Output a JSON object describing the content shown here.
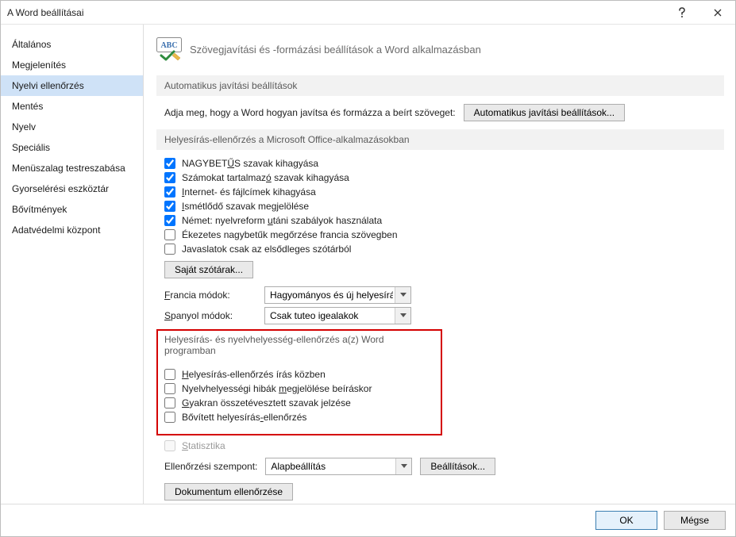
{
  "window": {
    "title": "A Word beállításai"
  },
  "sidebar": {
    "items": [
      {
        "label": "Általános"
      },
      {
        "label": "Megjelenítés"
      },
      {
        "label": "Nyelvi ellenőrzés"
      },
      {
        "label": "Mentés"
      },
      {
        "label": "Nyelv"
      },
      {
        "label": "Speciális"
      },
      {
        "label": "Menüszalag testreszabása"
      },
      {
        "label": "Gyorselérési eszköztár"
      },
      {
        "label": "Bővítmények"
      },
      {
        "label": "Adatvédelmi központ"
      }
    ],
    "selected_index": 2
  },
  "header": {
    "text": "Szövegjavítási és -formázási beállítások a Word alkalmazásban"
  },
  "section_autocorrect": {
    "title": "Automatikus javítási beállítások",
    "row_label": "Adja meg, hogy a Word hogyan javítsa és formázza a beírt szöveget:",
    "button": "Automatikus javítási beállítások..."
  },
  "section_office": {
    "title": "Helyesírás-ellenőrzés a Microsoft Office-alkalmazásokban",
    "opts": [
      {
        "pre": "NAGYBET",
        "u": "Ű",
        "post": "S szavak kihagyása",
        "checked": true
      },
      {
        "pre": "Számokat tartalmaz",
        "u": "ó",
        "post": " szavak kihagyása",
        "checked": true
      },
      {
        "pre": "",
        "u": "I",
        "post": "nternet- és fájlcímek kihagyása",
        "checked": true
      },
      {
        "pre": "",
        "u": "I",
        "post": "smétlődő szavak megjelölése",
        "checked": true
      },
      {
        "pre": "Német: nyelvreform ",
        "u": "u",
        "post": "táni szabályok használata",
        "checked": true
      },
      {
        "pre": "Ékezetes nagybetűk megőrzése francia szövegben",
        "u": "",
        "post": "",
        "checked": false
      },
      {
        "pre": "Javaslatok csak az elsődleges szótárból",
        "u": "",
        "post": "",
        "checked": false
      }
    ],
    "dict_btn": "Saját szótárak...",
    "french_label": "Francia módok:",
    "french_value": "Hagyományos és új helyesírás",
    "spanish_label": "Spanyol módok:",
    "spanish_value": "Csak tuteo igealakok"
  },
  "section_word": {
    "title": "Helyesírás- és nyelvhelyesség-ellenőrzés a(z) Word programban",
    "opts": [
      {
        "pre": "",
        "u": "H",
        "post": "elyesírás-ellenőrzés írás közben",
        "checked": false
      },
      {
        "pre": "Nyelvhelyességi hibák ",
        "u": "m",
        "post": "egjelölése beíráskor",
        "checked": false
      },
      {
        "pre": "",
        "u": "G",
        "post": "yakran összetévesztett szavak jelzése",
        "checked": false
      },
      {
        "pre": "Bővített helyesírás",
        "u": "-",
        "post": "ellenőrzés",
        "checked": false
      }
    ],
    "stat_pre": "",
    "stat_u": "S",
    "stat_post": "tatisztika",
    "aspect_label": "Ellenőrzési szempont:",
    "aspect_value": "Alapbeállítás",
    "settings_btn": "Beállítások...",
    "recheck_btn": "Dokumentum ellenőrzése"
  },
  "footer": {
    "ok": "OK",
    "cancel": "Mégse"
  }
}
